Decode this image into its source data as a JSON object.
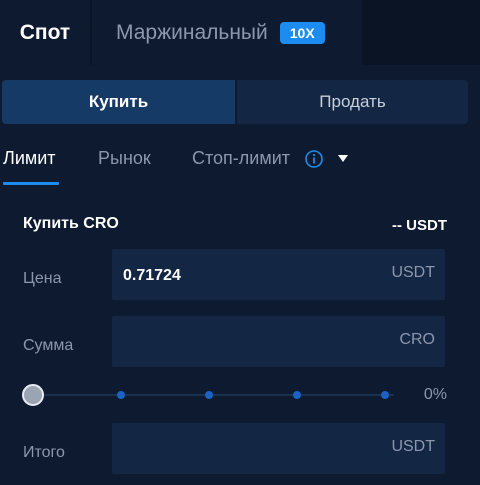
{
  "tabs": {
    "spot_label": "Спот",
    "margin_label": "Маржинальный",
    "leverage_badge": "10X"
  },
  "side_switch": {
    "buy_label": "Купить",
    "sell_label": "Продать"
  },
  "order_types": {
    "limit": "Лимит",
    "market": "Рынок",
    "stop_limit": "Стоп-лимит",
    "active": "limit"
  },
  "form": {
    "title": "Купить CRO",
    "balance": "-- USDT",
    "price": {
      "label": "Цена",
      "value": "0.71724",
      "unit": "USDT"
    },
    "amount": {
      "label": "Сумма",
      "value": "",
      "unit": "CRO"
    },
    "slider": {
      "percent_text": "0%",
      "value_fraction": 0.0
    },
    "total": {
      "label": "Итого",
      "value": "",
      "unit": "USDT"
    }
  },
  "colors": {
    "accent": "#1d8cf0",
    "background": "#0e1a30",
    "field": "#132643",
    "muted_text": "#8c97ad"
  },
  "icons": {
    "info": "info-circle-icon",
    "caret": "caret-down-icon"
  }
}
